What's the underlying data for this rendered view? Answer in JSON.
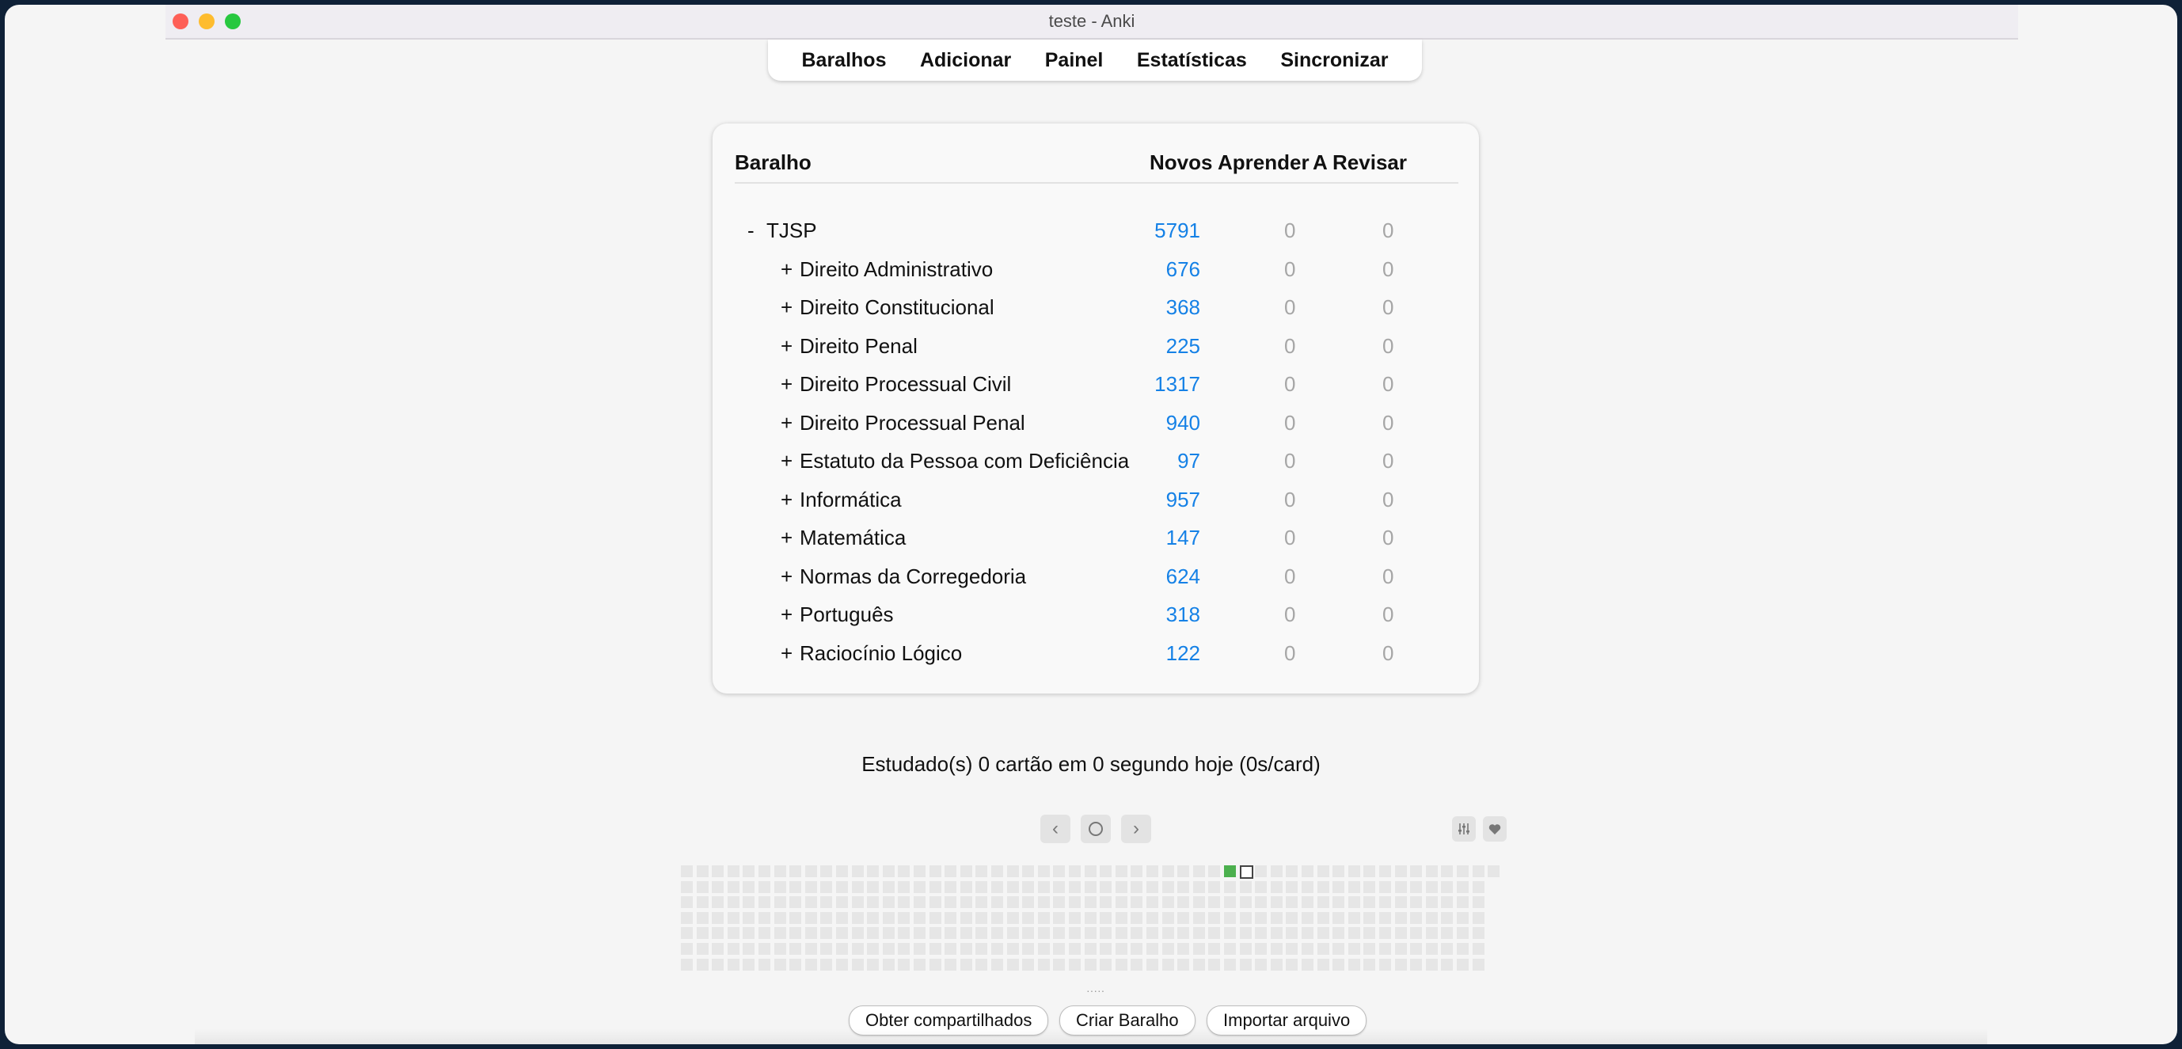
{
  "window": {
    "title": "teste - Anki"
  },
  "toolbar": {
    "items": [
      "Baralhos",
      "Adicionar",
      "Painel",
      "Estatísticas",
      "Sincronizar"
    ]
  },
  "deck_table": {
    "headers": {
      "deck": "Baralho",
      "new": "Novos",
      "learn": "Aprender",
      "review": "A Revisar"
    },
    "rows": [
      {
        "toggle": "-",
        "name": "TJSP",
        "new": "5791",
        "learn": "0",
        "review": "0",
        "level": 0
      },
      {
        "toggle": "+",
        "name": "Direito Administrativo",
        "new": "676",
        "learn": "0",
        "review": "0",
        "level": 1
      },
      {
        "toggle": "+",
        "name": "Direito Constitucional",
        "new": "368",
        "learn": "0",
        "review": "0",
        "level": 1
      },
      {
        "toggle": "+",
        "name": "Direito Penal",
        "new": "225",
        "learn": "0",
        "review": "0",
        "level": 1
      },
      {
        "toggle": "+",
        "name": "Direito Processual Civil",
        "new": "1317",
        "learn": "0",
        "review": "0",
        "level": 1
      },
      {
        "toggle": "+",
        "name": "Direito Processual Penal",
        "new": "940",
        "learn": "0",
        "review": "0",
        "level": 1
      },
      {
        "toggle": "+",
        "name": "Estatuto da Pessoa com Deficiência",
        "new": "97",
        "learn": "0",
        "review": "0",
        "level": 1
      },
      {
        "toggle": "+",
        "name": "Informática",
        "new": "957",
        "learn": "0",
        "review": "0",
        "level": 1
      },
      {
        "toggle": "+",
        "name": "Matemática",
        "new": "147",
        "learn": "0",
        "review": "0",
        "level": 1
      },
      {
        "toggle": "+",
        "name": "Normas da Corregedoria",
        "new": "624",
        "learn": "0",
        "review": "0",
        "level": 1
      },
      {
        "toggle": "+",
        "name": "Português",
        "new": "318",
        "learn": "0",
        "review": "0",
        "level": 1
      },
      {
        "toggle": "+",
        "name": "Raciocínio Lógico",
        "new": "122",
        "learn": "0",
        "review": "0",
        "level": 1
      }
    ]
  },
  "study_stats": "Estudado(s) 0 cartão em 0 segundo hoje (0s/card)",
  "heatmap": {
    "nav_icons": [
      "chevron-left-icon",
      "circle-icon",
      "chevron-right-icon"
    ],
    "options_icons": [
      "sliders-icon",
      "heart-icon"
    ],
    "colors": {
      "empty": "#e6e6e6",
      "studied": "#4cb04e"
    }
  },
  "footer_buttons": [
    "Obter compartilhados",
    "Criar Baralho",
    "Importar arquivo"
  ]
}
